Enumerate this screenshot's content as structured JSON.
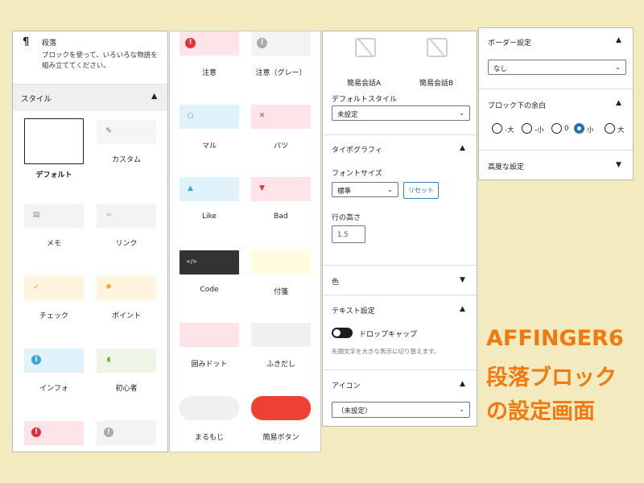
{
  "panel1": {
    "block_icon": "¶",
    "block_title": "段落",
    "block_desc": "ブロックを使って、いろいろな物語を組み立ててください。",
    "style_heading": "スタイル",
    "styles": [
      {
        "label": "デフォルト",
        "icon": "none",
        "bg": "#ffffff",
        "border": "#1e1e1e",
        "selected": true
      },
      {
        "label": "カスタム",
        "icon": "pencil-icon",
        "bg": "#f5f5f5",
        "color": "#666666"
      },
      {
        "label": "メモ",
        "icon": "note-icon",
        "bg": "#f3f3f3",
        "color": "#888888"
      },
      {
        "label": "リンク",
        "icon": "link-icon",
        "bg": "#f3f3f3",
        "color": "#aaaaaa"
      },
      {
        "label": "チェック",
        "icon": "check-icon",
        "bg": "#fff4de",
        "color": "#f0a020"
      },
      {
        "label": "ポイント",
        "icon": "bulb-icon",
        "bg": "#fff4de",
        "color": "#f0a020"
      },
      {
        "label": "インフォ",
        "icon": "info-icon",
        "bg": "#e0f3fb",
        "color": "#3aa8dc"
      },
      {
        "label": "初心者",
        "icon": "beginner-icon",
        "bg": "#eef5e6",
        "color": "#6aab3a"
      },
      {
        "label": "",
        "icon": "alert-icon",
        "bg": "#fde4e8",
        "color": "#e0303a"
      },
      {
        "label": "",
        "icon": "alert-icon",
        "bg": "#f3f3f3",
        "color": "#aaaaaa"
      }
    ]
  },
  "panel2": {
    "styles": [
      {
        "label": "注意",
        "icon": "alert-icon",
        "bg": "#fde4e8",
        "color": "#e0303a"
      },
      {
        "label": "注意（グレー）",
        "icon": "alert-icon",
        "bg": "#f3f3f3",
        "color": "#aaaaaa"
      },
      {
        "label": "マル",
        "icon": "circle-icon",
        "bg": "#e0f3fb",
        "color": "#3aa8dc"
      },
      {
        "label": "バツ",
        "icon": "cross-icon",
        "bg": "#fde4e8",
        "color": "#e0303a"
      },
      {
        "label": "Like",
        "icon": "thumbs-up-icon",
        "bg": "#e0f3fb",
        "color": "#3aa8dc"
      },
      {
        "label": "Bad",
        "icon": "thumbs-down-icon",
        "bg": "#fde4e8",
        "color": "#e0303a"
      },
      {
        "label": "Code",
        "icon": "code-icon",
        "bg": "#333333",
        "color": "#ffffff"
      },
      {
        "label": "付箋",
        "icon": "none",
        "bg": "#fffce0",
        "color": "#ffffff"
      },
      {
        "label": "囲みドット",
        "icon": "none",
        "bg": "#fde4e8",
        "color": "#ffffff"
      },
      {
        "label": "ふきだし",
        "icon": "none",
        "bg": "#f0f0f0",
        "color": "#ffffff"
      },
      {
        "label": "まるもじ",
        "icon": "none",
        "bg": "#f0f0f0",
        "color": "#ffffff",
        "round": true
      },
      {
        "label": "簡易ボタン",
        "icon": "none",
        "bg": "#ef4133",
        "color": "#ffffff",
        "round": true
      }
    ]
  },
  "panel3": {
    "conv_a": "簡易会話A",
    "conv_b": "簡易会話B",
    "default_style_label": "デフォルトスタイル",
    "default_style_value": "未設定",
    "typography_heading": "タイポグラフィ",
    "font_size_label": "フォントサイズ",
    "font_size_value": "標準",
    "reset_label": "リセット",
    "line_height_label": "行の高さ",
    "line_height_value": "1.5",
    "color_heading": "色",
    "text_settings_heading": "テキスト設定",
    "dropcap_label": "ドロップキャップ",
    "dropcap_help": "先頭文字を大きな表示に切り替えます。",
    "icon_heading": "アイコン",
    "icon_value": "（未設定）"
  },
  "panel4": {
    "border_heading": "ボーダー設定",
    "border_value": "なし",
    "margin_heading": "ブロック下の余白",
    "margin_options": [
      "-大",
      "-小",
      "0",
      "小",
      "大"
    ],
    "margin_selected": "小",
    "advanced_heading": "高度な設定"
  },
  "caption": {
    "line1": "AFFINGER6",
    "line2": "段落ブロック",
    "line3": "の設定画面"
  }
}
